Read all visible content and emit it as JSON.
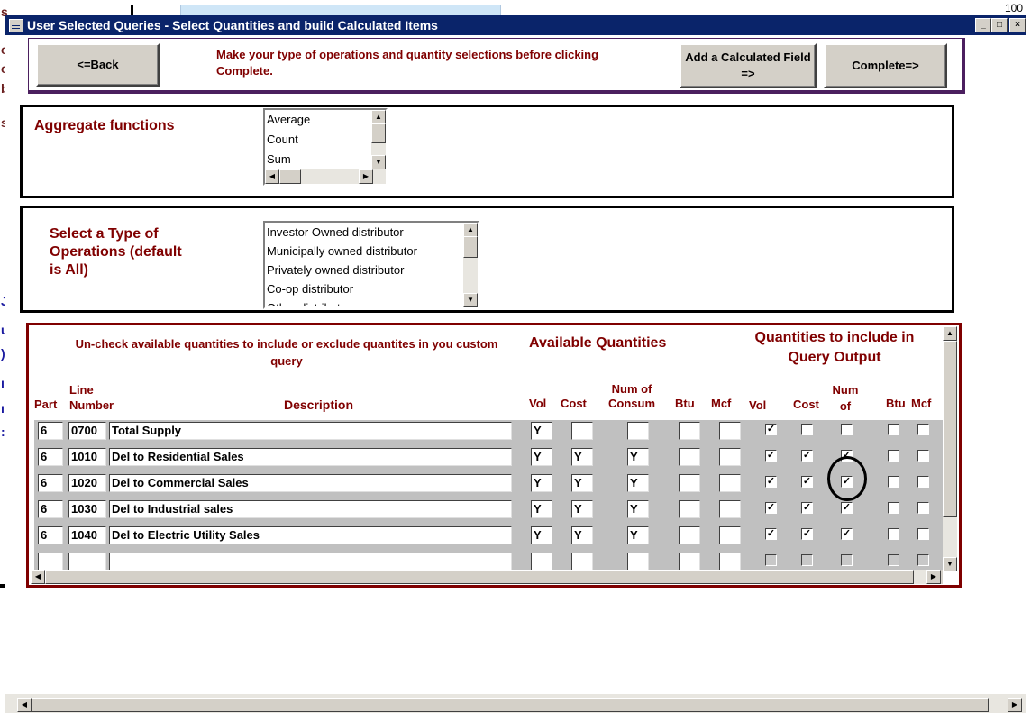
{
  "window": {
    "title": "User Selected Queries - Select Quantities and build Calculated Items",
    "minimize": "_",
    "maximize": "□",
    "close": "×"
  },
  "background": {
    "top_right": "100",
    "left_letters": [
      "s",
      "c",
      "c",
      "b",
      "s"
    ],
    "left_letters2": [
      "J",
      "u",
      ")",
      "ı",
      "ı",
      ":"
    ]
  },
  "toolbar": {
    "back_label": "<=Back",
    "instruction": "Make your type of operations and quantity selections before clicking Complete.",
    "add_calc_label": "Add a Calculated Field =>",
    "complete_label": "Complete=>"
  },
  "aggregate": {
    "label": "Aggregate functions",
    "items": [
      "Average",
      "Count",
      "Sum"
    ]
  },
  "operations": {
    "label": "Select a Type of Operations (default is All)",
    "items": [
      "Investor Owned distributor",
      "Municipally owned distributor",
      "Privately owned distributor",
      "Co-op distributor",
      "Other distributor"
    ]
  },
  "quantities": {
    "instruction": "Un-check available quantities to include or exclude quantites in you custom query",
    "available_header": "Available Quantities",
    "output_header": "Quantities to include in Query Output",
    "columns": {
      "part": "Part",
      "line_number": "Line Number",
      "description": "Description",
      "vol": "Vol",
      "cost": "Cost",
      "num_consum": "Num of Consum",
      "btu": "Btu",
      "mcf": "Mcf",
      "out_vol": "Vol",
      "out_cost": "Cost",
      "out_num": "Num of",
      "out_btu": "Btu",
      "out_mcf": "Mcf"
    },
    "rows": [
      {
        "part": "6",
        "line": "0700",
        "desc": "Total Supply",
        "vol": "Y",
        "cost": "",
        "num": "",
        "btu": "",
        "mcf": "",
        "o_vol": true,
        "o_cost": false,
        "o_num": false,
        "o_btu": false,
        "o_mcf": false
      },
      {
        "part": "6",
        "line": "1010",
        "desc": "Del to Residential Sales",
        "vol": "Y",
        "cost": "Y",
        "num": "Y",
        "btu": "",
        "mcf": "",
        "o_vol": true,
        "o_cost": true,
        "o_num": true,
        "o_btu": false,
        "o_mcf": false
      },
      {
        "part": "6",
        "line": "1020",
        "desc": "Del to Commercial Sales",
        "vol": "Y",
        "cost": "Y",
        "num": "Y",
        "btu": "",
        "mcf": "",
        "o_vol": true,
        "o_cost": true,
        "o_num": true,
        "o_btu": false,
        "o_mcf": false
      },
      {
        "part": "6",
        "line": "1030",
        "desc": "Del to Industrial sales",
        "vol": "Y",
        "cost": "Y",
        "num": "Y",
        "btu": "",
        "mcf": "",
        "o_vol": true,
        "o_cost": true,
        "o_num": true,
        "o_btu": false,
        "o_mcf": false
      },
      {
        "part": "6",
        "line": "1040",
        "desc": "Del to Electric Utility Sales",
        "vol": "Y",
        "cost": "Y",
        "num": "Y",
        "btu": "",
        "mcf": "",
        "o_vol": true,
        "o_cost": true,
        "o_num": true,
        "o_btu": false,
        "o_mcf": false
      }
    ],
    "check_mark": "✓"
  },
  "colors": {
    "titlebar": "#0a246a",
    "maroon": "#800000",
    "face": "#d4d0c8"
  }
}
